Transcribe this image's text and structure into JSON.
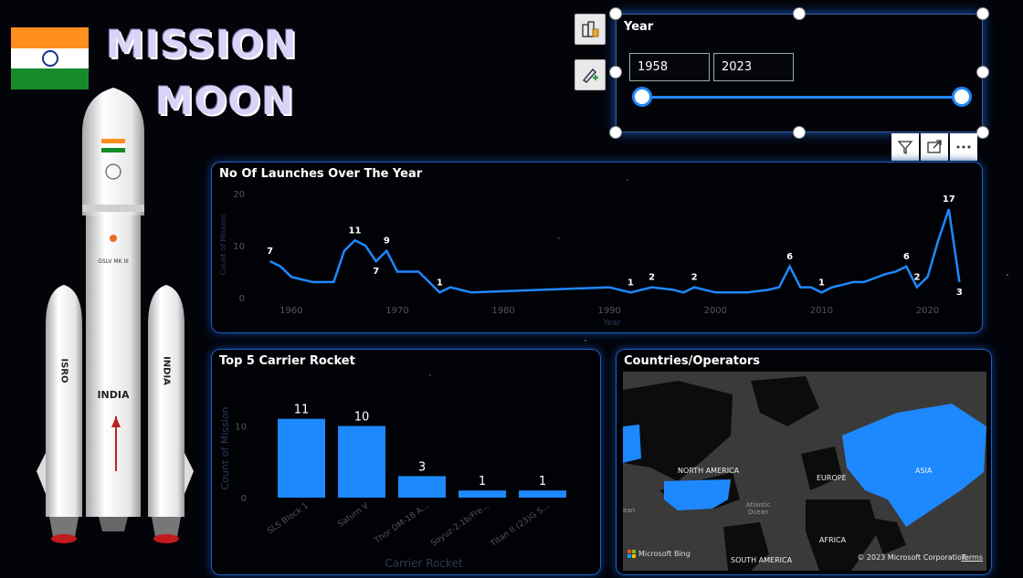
{
  "header": {
    "title_line1": "MISSION",
    "title_line2": "MOON",
    "flag_colors": {
      "saffron": "#ff8f1f",
      "white": "#ffffff",
      "green": "#168a2b",
      "chakra": "#1c2f8a"
    }
  },
  "rocket": {
    "body_labels": [
      "INDIA",
      "ISRO",
      "INDIA"
    ],
    "model_label": "GSLV MK III"
  },
  "slicer": {
    "title": "Year",
    "start_value": "1958",
    "end_value": "2023",
    "icons": [
      "format-visual-icon",
      "add-paint-icon"
    ]
  },
  "visual_actions": [
    "filter-icon",
    "focus-mode-icon",
    "more-options-icon"
  ],
  "line_chart": {
    "title": "No Of Launches Over The Year",
    "xlabel": "Year",
    "ylabel": "Count of Mission"
  },
  "bar_chart": {
    "title": "Top 5 Carrier Rocket",
    "xlabel": "Carrier Rocket",
    "ylabel": "Count of Mission"
  },
  "map": {
    "title": "Countries/Operators",
    "labels": [
      "NORTH AMERICA",
      "EUROPE",
      "ASIA",
      "AFRICA",
      "SOUTH AMERICA",
      "Atlantic Ocean",
      "ean"
    ],
    "attribution": "Microsoft Bing",
    "copyright": "© 2023 Microsoft Corporation",
    "terms": "Terms",
    "highlight_color": "#1e88ff"
  },
  "chart_data": [
    {
      "type": "line",
      "title": "No Of Launches Over The Year",
      "xlabel": "Year",
      "ylabel": "Count of Mission",
      "xlim": [
        1957,
        2024
      ],
      "ylim": [
        0,
        20
      ],
      "x_ticks": [
        1960,
        1970,
        1980,
        1990,
        2000,
        2010,
        2020
      ],
      "y_ticks": [
        0,
        10,
        20
      ],
      "grid": false,
      "color": "#1e88ff",
      "x": [
        1958,
        1959,
        1960,
        1962,
        1963,
        1964,
        1965,
        1966,
        1967,
        1968,
        1969,
        1970,
        1971,
        1972,
        1973,
        1974,
        1975,
        1977,
        1990,
        1992,
        1994,
        1996,
        1997,
        1998,
        2000,
        2002,
        2003,
        2005,
        2006,
        2007,
        2008,
        2009,
        2010,
        2011,
        2012,
        2013,
        2014,
        2016,
        2017,
        2018,
        2019,
        2020,
        2021,
        2022,
        2023
      ],
      "y": [
        7,
        6,
        4,
        3,
        3,
        3,
        9,
        11,
        10,
        7,
        9,
        5,
        5,
        5,
        3,
        1,
        2,
        1,
        2,
        1,
        2,
        1.5,
        1,
        2,
        1,
        1,
        1,
        1.5,
        2,
        6,
        2,
        2,
        1,
        2,
        2.5,
        3,
        3,
        4.5,
        5,
        6,
        2,
        4,
        11,
        17,
        3
      ],
      "data_labels": [
        {
          "x": 1958,
          "y": 7,
          "text": "7"
        },
        {
          "x": 1966,
          "y": 11,
          "text": "11"
        },
        {
          "x": 1968,
          "y": 7,
          "text": "7"
        },
        {
          "x": 1969,
          "y": 9,
          "text": "9"
        },
        {
          "x": 1974,
          "y": 1,
          "text": "1"
        },
        {
          "x": 1992,
          "y": 1,
          "text": "1"
        },
        {
          "x": 1994,
          "y": 2,
          "text": "2"
        },
        {
          "x": 1998,
          "y": 2,
          "text": "2"
        },
        {
          "x": 2007,
          "y": 6,
          "text": "6"
        },
        {
          "x": 2010,
          "y": 1,
          "text": "1"
        },
        {
          "x": 2018,
          "y": 6,
          "text": "6"
        },
        {
          "x": 2019,
          "y": 2,
          "text": "2"
        },
        {
          "x": 2022,
          "y": 17,
          "text": "17"
        },
        {
          "x": 2023,
          "y": 3,
          "text": "3"
        }
      ]
    },
    {
      "type": "bar",
      "title": "Top 5 Carrier Rocket",
      "xlabel": "Carrier Rocket",
      "ylabel": "Count of Mission",
      "categories": [
        "SLS Block 1",
        "Saturn V",
        "Thor DM-18 A...",
        "Soyuz-2.1b/Fre...",
        "Titan II (23)G S..."
      ],
      "values": [
        11,
        10,
        3,
        1,
        1
      ],
      "ylim": [
        0,
        13
      ],
      "y_ticks": [
        0,
        10
      ],
      "color": "#1e88ff"
    }
  ]
}
